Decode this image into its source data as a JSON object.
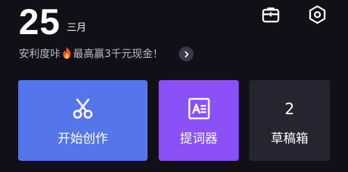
{
  "header": {
    "day": "25",
    "month": "三月",
    "icons": [
      "briefcase-icon",
      "settings-hexagon-icon"
    ]
  },
  "promo": {
    "text_before": "安利度咔",
    "icon": "fire-icon",
    "text_after": "最高赢3千元现金！",
    "arrow_icon": "chevron-right-icon"
  },
  "cards": {
    "create": {
      "label": "开始创作",
      "icon": "scissors-icon",
      "color": "#5476e8"
    },
    "prompter": {
      "label": "提词器",
      "icon": "teleprompter-icon",
      "color": "#8a52f6"
    },
    "drafts": {
      "label": "草稿箱",
      "count": "2",
      "color": "#26252f"
    }
  },
  "colors": {
    "background": "#111017",
    "promo_text": "#bdbcc6"
  }
}
